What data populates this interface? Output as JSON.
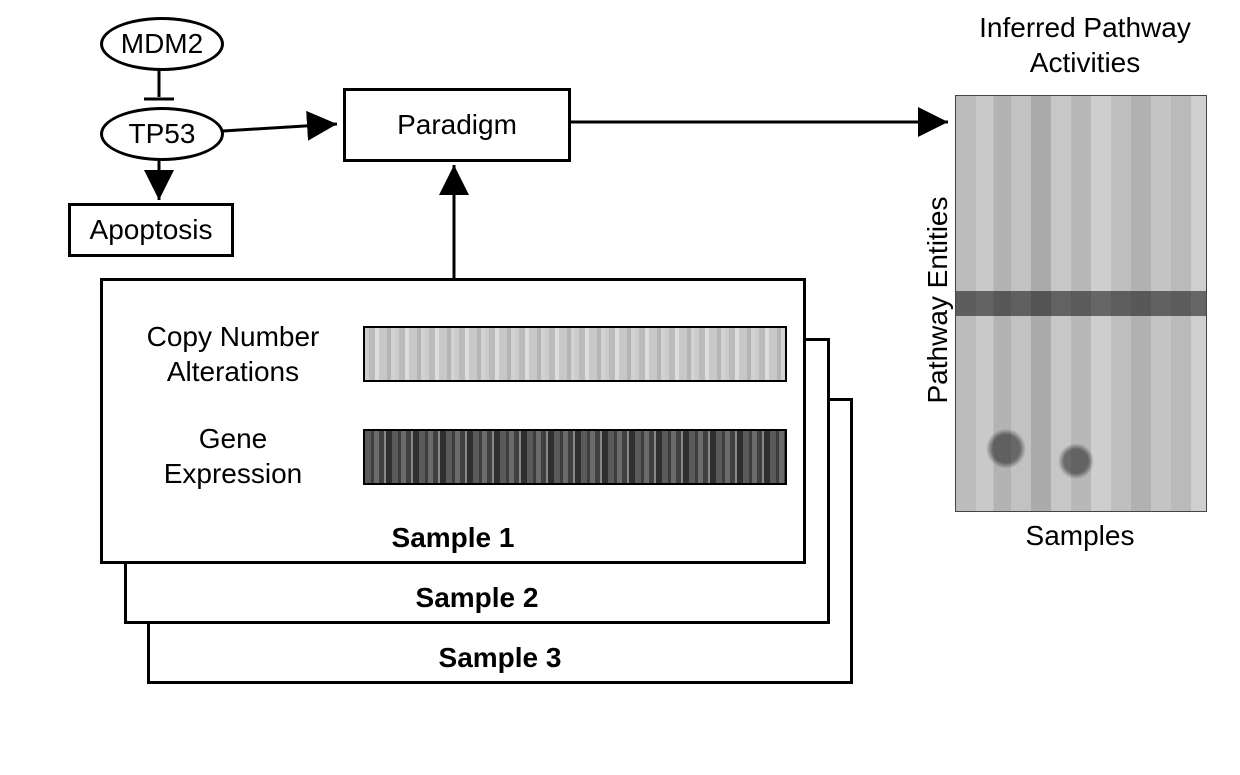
{
  "nodes": {
    "mdm2": "MDM2",
    "tp53": "TP53",
    "apoptosis": "Apoptosis",
    "paradigm": "Paradigm"
  },
  "sample_card": {
    "cna_label": "Copy Number\nAlterations",
    "gene_expr_label": "Gene\nExpression",
    "sample1": "Sample 1",
    "sample2": "Sample 2",
    "sample3": "Sample 3"
  },
  "heatmap": {
    "title": "Inferred Pathway\nActivities",
    "y_axis": "Pathway Entities",
    "x_axis": "Samples"
  }
}
